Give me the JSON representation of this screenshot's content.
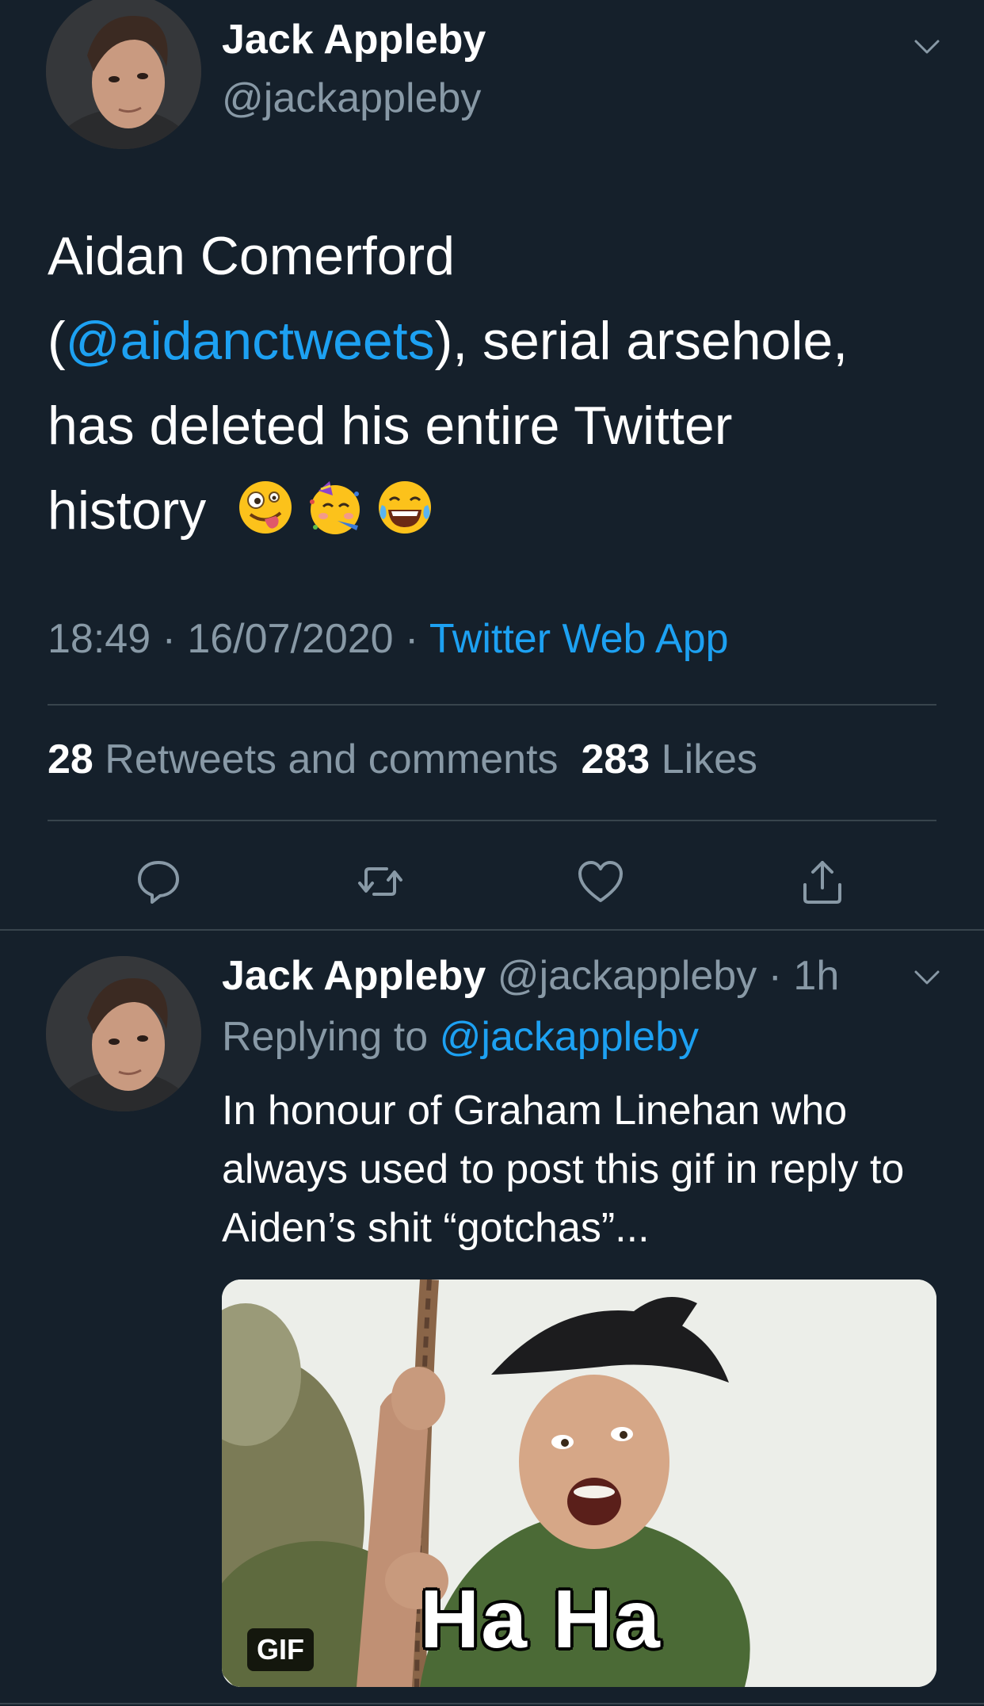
{
  "main_tweet": {
    "author_name": "Jack Appleby",
    "author_handle": "@jackappleby",
    "text": {
      "line1": "Aidan Comerford",
      "open_paren": "(",
      "mention": "@aidanctweets",
      "after_mention": "), serial arsehole,",
      "line3": "has deleted his entire Twitter",
      "line4": "history"
    },
    "emojis": [
      "zany-face-emoji",
      "partying-face-emoji",
      "tears-of-joy-emoji"
    ],
    "timestamp": "18:49 · 16/07/2020 · ",
    "source": "Twitter Web App",
    "retweets_count": "28",
    "retweets_label": " Retweets and comments",
    "likes_count": "283",
    "likes_label": " Likes",
    "actions": [
      "reply-icon",
      "retweet-icon",
      "like-icon",
      "share-icon"
    ]
  },
  "reply_tweet": {
    "author_name": "Jack Appleby",
    "author_handle": "@jackappleby",
    "separator": " · ",
    "time": "1h",
    "replying_to_label": "Replying to ",
    "replying_to_handle": "@jackappleby",
    "text": "In honour of Graham Linehan who always used to post this gif in reply to Aiden’s shit “gotchas”...",
    "gif_caption": "Ha Ha",
    "gif_badge": "GIF"
  },
  "colors": {
    "background": "#15202b",
    "accent": "#1da1f2",
    "secondary_text": "#8899a6",
    "divider": "#38444d"
  }
}
